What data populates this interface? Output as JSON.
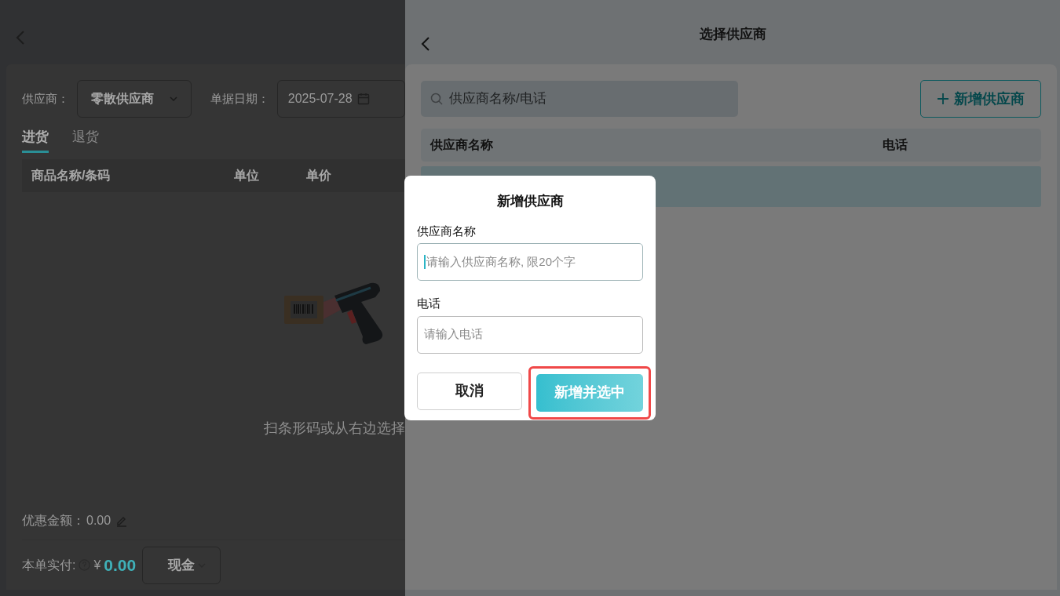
{
  "purchase": {
    "supplier_label": "供应商：",
    "supplier_value": "零散供应商",
    "date_label": "单据日期：",
    "date_value": "2025-07-28",
    "tabs": [
      {
        "label": "进货",
        "selected": true
      },
      {
        "label": "退货",
        "selected": false
      }
    ],
    "table": {
      "columns": [
        "商品名称/条码",
        "单位",
        "单价"
      ]
    },
    "empty_text": "扫条形码或从右边选择",
    "discount_label": "优惠金额：",
    "discount_value": "0.00",
    "paid_label": "本单实付:",
    "currency": "¥",
    "paid_value": "0.00",
    "payment_method": "现金"
  },
  "supplier_panel": {
    "title": "选择供应商",
    "search": {
      "placeholder": "供应商名称/电话"
    },
    "add_button": "新增供应商",
    "table": {
      "columns": [
        "供应商名称",
        "电话"
      ],
      "rows": [
        {
          "selected": true
        }
      ]
    }
  },
  "dialog": {
    "title": "新增供应商",
    "fields": [
      {
        "label": "供应商名称",
        "placeholder": "请输入供应商名称, 限20个字",
        "focused": true
      },
      {
        "label": "电话",
        "placeholder": "请输入电话",
        "focused": false
      }
    ],
    "cancel": "取消",
    "confirm": {
      "label": "新增并选中",
      "highlighted": true
    }
  }
}
